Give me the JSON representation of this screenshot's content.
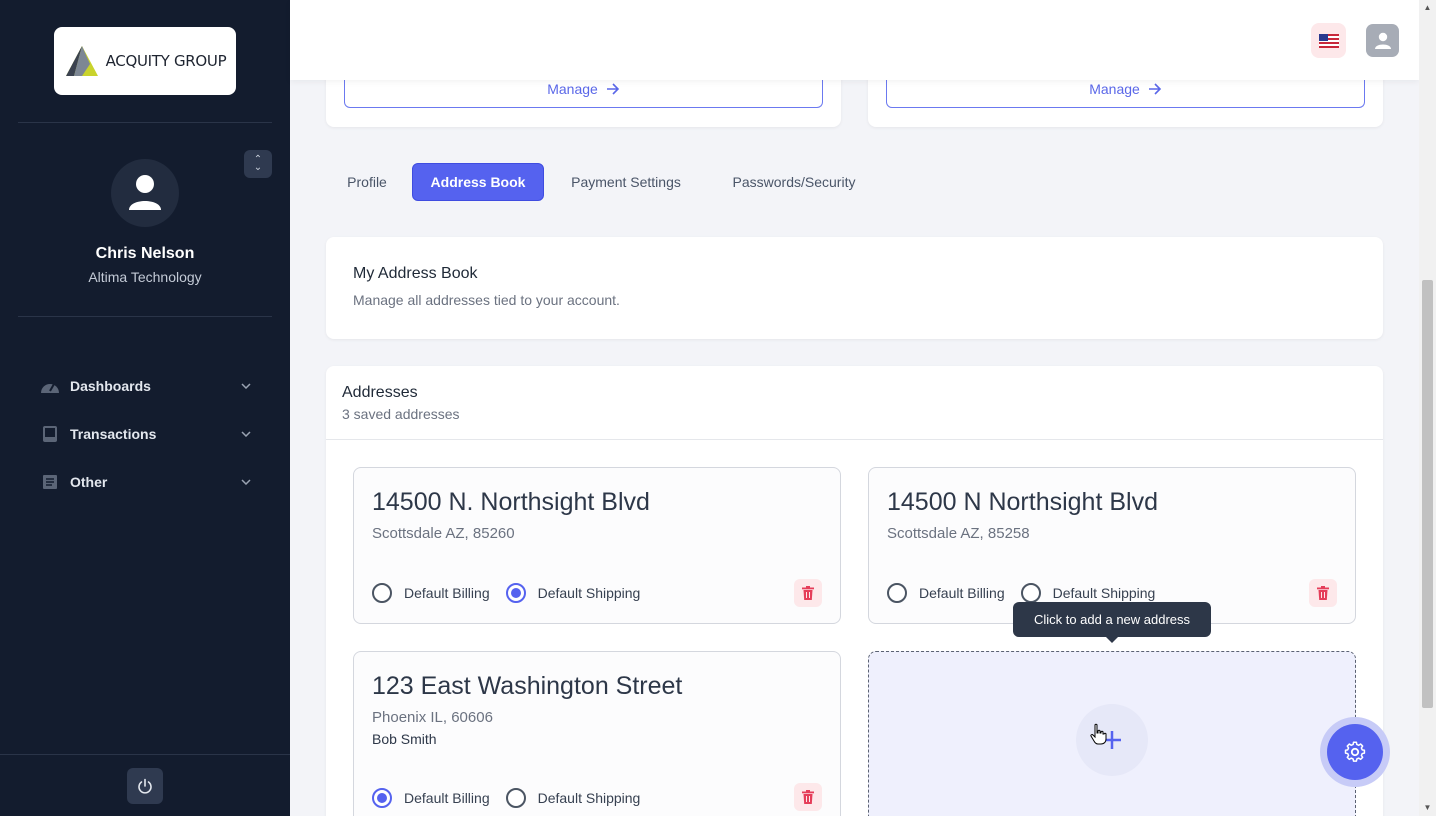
{
  "sidebar": {
    "logo_text": "ACQUITY GROUP",
    "user_name": "Chris Nelson",
    "user_org": "Altima Technology",
    "nav": [
      {
        "label": "Dashboards",
        "icon": "gauge-icon"
      },
      {
        "label": "Transactions",
        "icon": "inbox-icon"
      },
      {
        "label": "Other",
        "icon": "list-icon"
      }
    ]
  },
  "header": {
    "flag_icon": "us-flag-icon",
    "user_icon": "user-icon"
  },
  "top_cards": [
    {
      "manage_label": "Manage"
    },
    {
      "manage_label": "Manage"
    }
  ],
  "tabs": [
    {
      "label": "Profile",
      "active": false
    },
    {
      "label": "Address Book",
      "active": true
    },
    {
      "label": "Payment Settings",
      "active": false
    },
    {
      "label": "Passwords/Security",
      "active": false
    }
  ],
  "address_book": {
    "title": "My Address Book",
    "subtitle": "Manage all addresses tied to your account."
  },
  "addresses_panel": {
    "title": "Addresses",
    "subtitle": "3 saved addresses",
    "billing_label": "Default Billing",
    "shipping_label": "Default Shipping",
    "items": [
      {
        "line1": "14500 N. Northsight Blvd",
        "line2": "Scottsdale AZ, 85260",
        "line3": "",
        "default_billing": false,
        "default_shipping": true
      },
      {
        "line1": "14500 N Northsight Blvd",
        "line2": "Scottsdale AZ, 85258",
        "line3": "",
        "default_billing": false,
        "default_shipping": false
      },
      {
        "line1": "123 East Washington Street",
        "line2": "Phoenix IL, 60606",
        "line3": "Bob Smith",
        "default_billing": true,
        "default_shipping": false
      }
    ],
    "add_tooltip": "Click to add a new address"
  },
  "colors": {
    "sidebar_bg": "#131c2e",
    "accent": "#5562ef",
    "danger_bg": "#fde8ea",
    "danger": "#e53e5a"
  }
}
